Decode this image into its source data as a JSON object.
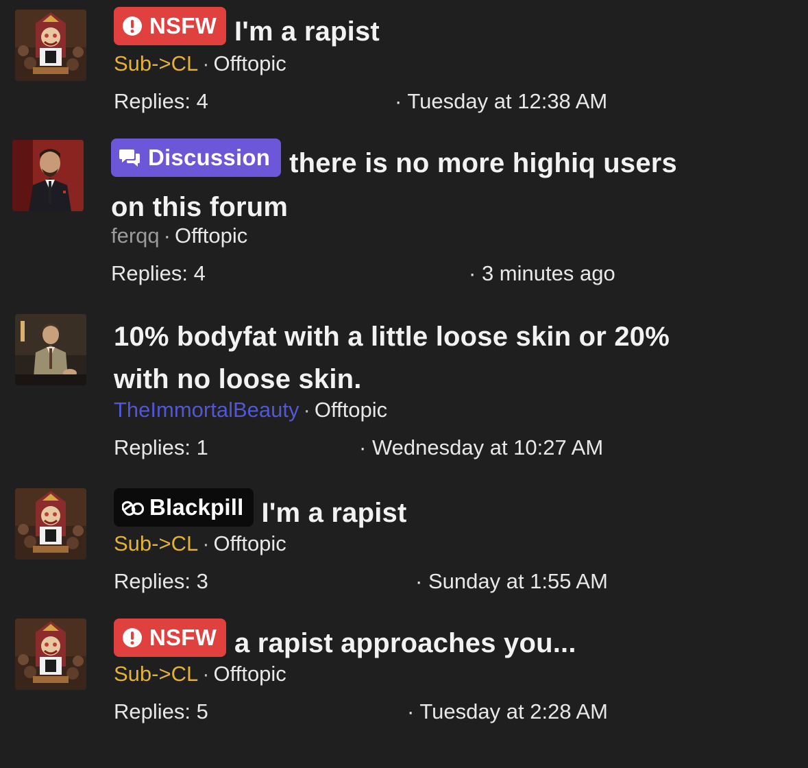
{
  "threads": [
    {
      "prefix": "NSFW",
      "prefix_type": "nsfw",
      "prefix_icon": "exclamation-circle-icon",
      "title": "I'm a rapist",
      "author": "Sub->CL",
      "author_color": "#e4b333",
      "forum": "Offtopic",
      "replies": "Replies: 4",
      "date": "Tuesday at 12:38 AM",
      "avatar_icon": "throne-king-avatar"
    },
    {
      "prefix": "Discussion",
      "prefix_type": "discussion",
      "prefix_icon": "chat-bubbles-icon",
      "title_line1": "there is no more highiq users",
      "title_line2": "on this forum",
      "author": "ferqq",
      "author_color": "#9b9b9b",
      "forum": "Offtopic",
      "replies": "Replies: 4",
      "date": "3 minutes ago",
      "avatar_icon": "suited-man-avatar"
    },
    {
      "title_line1": "10% bodyfat with a little loose skin or 20%",
      "title_line2": "with no loose skin.",
      "author": "TheImmortalBeauty",
      "author_color": "#5157d6",
      "forum": "Offtopic",
      "replies": "Replies: 1",
      "date": "Wednesday at 10:27 AM",
      "avatar_icon": "seated-man-avatar"
    },
    {
      "prefix": "Blackpill",
      "prefix_type": "blackpill",
      "prefix_icon": "pills-icon",
      "title": "I'm a rapist",
      "author": "Sub->CL",
      "author_color": "#e4b333",
      "forum": "Offtopic",
      "replies": "Replies: 3",
      "date": "Sunday at 1:55 AM",
      "avatar_icon": "throne-king-avatar"
    },
    {
      "prefix": "NSFW",
      "prefix_type": "nsfw",
      "prefix_icon": "exclamation-circle-icon",
      "title": "a rapist approaches you...",
      "author": "Sub->CL",
      "author_color": "#e4b333",
      "forum": "Offtopic",
      "replies": "Replies: 5",
      "date": "Tuesday at 2:28 AM",
      "avatar_icon": "throne-king-avatar"
    }
  ],
  "separator": "·",
  "colors": {
    "background": "#1f1f1f",
    "nsfw": "#e0413f",
    "discussion": "#6b57d8",
    "blackpill": "#0b0b0b"
  }
}
